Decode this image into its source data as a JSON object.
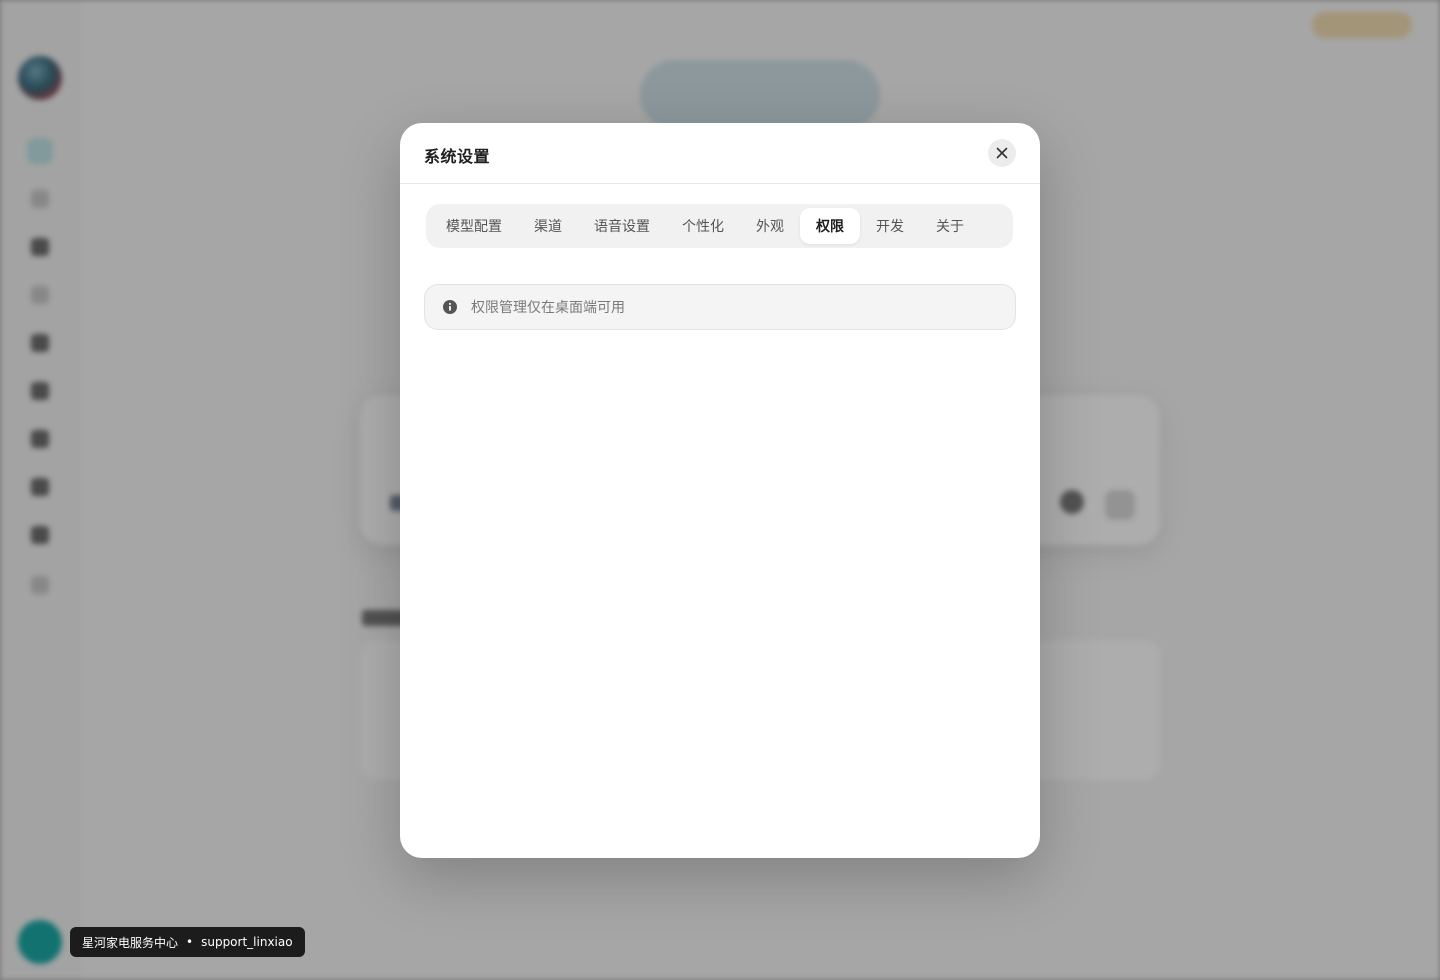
{
  "modal": {
    "title": "系统设置",
    "close_icon": "close-icon",
    "tabs": [
      {
        "label": "模型配置",
        "active": false
      },
      {
        "label": "渠道",
        "active": false
      },
      {
        "label": "语音设置",
        "active": false
      },
      {
        "label": "个性化",
        "active": false
      },
      {
        "label": "外观",
        "active": false
      },
      {
        "label": "权限",
        "active": true
      },
      {
        "label": "开发",
        "active": false
      },
      {
        "label": "关于",
        "active": false
      }
    ],
    "notice": {
      "icon": "info-icon",
      "text": "权限管理仅在桌面端可用"
    }
  },
  "tooltip": {
    "org": "星河家电服务中心",
    "separator": "•",
    "username": "support_linxiao"
  },
  "colors": {
    "overlay": "#ababab",
    "modal_bg": "#ffffff",
    "tab_bar_bg": "#f1f1f2",
    "active_tab_bg": "#ffffff",
    "tooltip_bg": "#1c1c1c",
    "avatar": "#1aa9a6"
  }
}
